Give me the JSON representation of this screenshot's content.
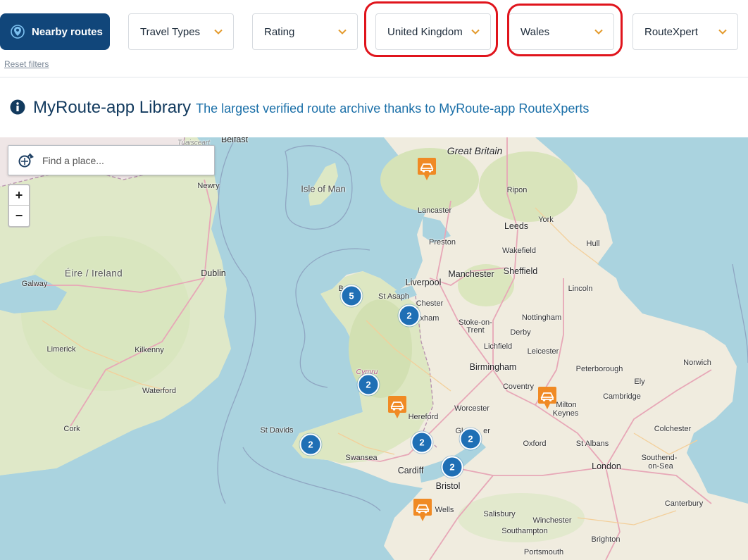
{
  "filters": {
    "nearby_label": "Nearby routes",
    "travel_types": "Travel Types",
    "rating": "Rating",
    "country": "United Kingdom",
    "region": "Wales",
    "routexpert": "RouteXpert",
    "reset_label": "Reset filters"
  },
  "heading": {
    "title": "MyRoute-app Library",
    "subtitle": "The largest verified route archive thanks to MyRoute-app RouteXperts"
  },
  "search": {
    "placeholder": "Find a place..."
  },
  "zoom": {
    "in": "+",
    "out": "−"
  },
  "map": {
    "labels": {
      "great_britain": "Great Britain",
      "isle_of_man": "Isle of Man",
      "eire": "Éire / Ireland",
      "belfast": "Belfast",
      "tuaisceart": "Tuaisceart",
      "newry": "Newry",
      "dublin": "Dublin",
      "galway": "Galway",
      "limerick": "Limerick",
      "kilkenny": "Kilkenny",
      "waterford": "Waterford",
      "cork": "Cork",
      "lancaster": "Lancaster",
      "ripon": "Ripon",
      "leeds": "Leeds",
      "york": "York",
      "preston": "Preston",
      "wakefield": "Wakefield",
      "hull": "Hull",
      "manchester": "Manchester",
      "sheffield": "Sheffield",
      "liverpool": "Liverpool",
      "st_asaph": "St Asaph",
      "chester": "Chester",
      "wrexham": "xham",
      "bangor": "B",
      "lincoln": "Lincoln",
      "stoke": "Stoke-on-",
      "trent": "Trent",
      "nottingham": "Nottingham",
      "lichfield": "Lichfield",
      "derby": "Derby",
      "leicester": "Leicester",
      "norwich": "Norwich",
      "birmingham": "Birmingham",
      "peterborough": "Peterborough",
      "cymru": "Cymru",
      "coventry": "Coventry",
      "ely": "Ely",
      "worcester": "Worcester",
      "hereford": "Hereford",
      "milton": "Milton",
      "keynes": "Keynes",
      "cambridge": "Cambridge",
      "st_davids": "St Davids",
      "gloucester_g": "Gl",
      "gloucester_er": "er",
      "oxford": "Oxford",
      "st_albans": "St Albans",
      "colchester": "Colchester",
      "swansea": "Swansea",
      "cardiff": "Cardiff",
      "bristol": "Bristol",
      "london": "London",
      "southend": "Southend-",
      "on_sea": "on-Sea",
      "wells": "Wells",
      "salisbury": "Salisbury",
      "winchester": "Winchester",
      "canterbury": "Canterbury",
      "southampton": "Southampton",
      "brighton": "Brighton",
      "portsmouth": "Portsmouth"
    },
    "clusters": [
      "5",
      "2",
      "2",
      "2",
      "2",
      "2",
      "2"
    ],
    "colors": {
      "water": "#aad3df",
      "land": "#f2efe9",
      "cluster": "#1f6fb5",
      "marker": "#f08a24",
      "primary": "#11467a",
      "highlight": "#e0141c"
    }
  }
}
